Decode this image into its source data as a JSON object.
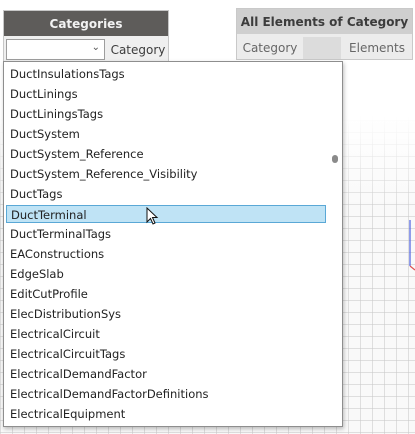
{
  "categories_node": {
    "title": "Categories",
    "dropdown_value": "",
    "output_port": "Category"
  },
  "all_elements_node": {
    "title": "All Elements of Category",
    "input_port": "Category",
    "output_port": "Elements"
  },
  "dropdown": {
    "selected_index": 7,
    "items": [
      "DuctInsulationsTags",
      "DuctLinings",
      "DuctLiningsTags",
      "DuctSystem",
      "DuctSystem_Reference",
      "DuctSystem_Reference_Visibility",
      "DuctTags",
      "DuctTerminal",
      "DuctTerminalTags",
      "EAConstructions",
      "EdgeSlab",
      "EditCutProfile",
      "ElecDistributionSys",
      "ElectricalCircuit",
      "ElectricalCircuitTags",
      "ElectricalDemandFactor",
      "ElectricalDemandFactorDefinitions",
      "ElectricalEquipment"
    ]
  },
  "colors": {
    "categories_header": "#5e5c5a",
    "selection_fill": "#bfe3f5",
    "selection_border": "#5aa8d6",
    "axis_red": "#e05050",
    "axis_blue": "#4a5ee0"
  }
}
